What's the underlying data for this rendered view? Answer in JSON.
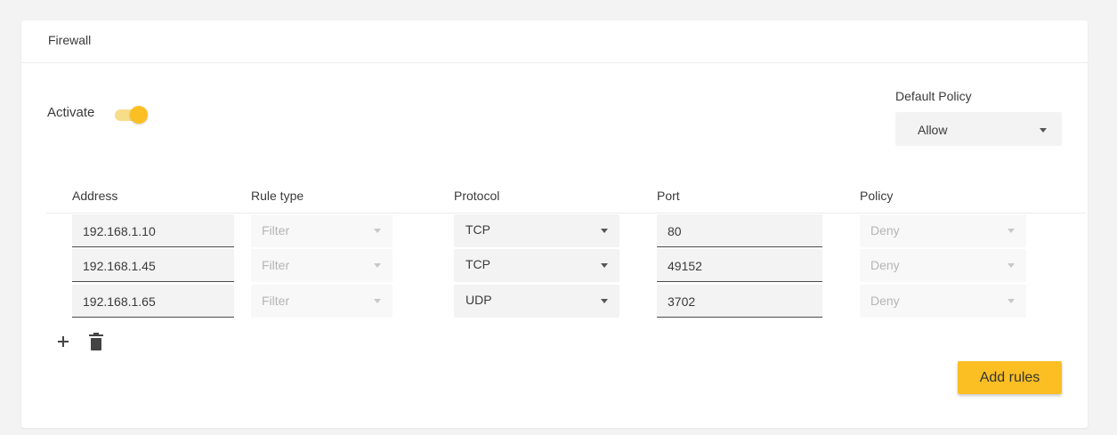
{
  "card": {
    "title": "Firewall"
  },
  "activate": {
    "label": "Activate",
    "enabled": true
  },
  "default_policy": {
    "label": "Default Policy",
    "value": "Allow"
  },
  "columns": [
    "Address",
    "Rule type",
    "Protocol",
    "Port",
    "Policy"
  ],
  "rules": [
    {
      "address": "192.168.1.10",
      "rule_type": "Filter",
      "protocol": "TCP",
      "port": "80",
      "policy": "Deny"
    },
    {
      "address": "192.168.1.45",
      "rule_type": "Filter",
      "protocol": "TCP",
      "port": "49152",
      "policy": "Deny"
    },
    {
      "address": "192.168.1.65",
      "rule_type": "Filter",
      "protocol": "UDP",
      "port": "3702",
      "policy": "Deny"
    }
  ],
  "actions": {
    "add_icon": "plus-icon",
    "delete_icon": "trash-icon",
    "add_rules_label": "Add rules"
  },
  "colors": {
    "accent": "#fbbf24",
    "toggle_track": "#f8dd88",
    "field_bg": "#f3f3f3"
  }
}
